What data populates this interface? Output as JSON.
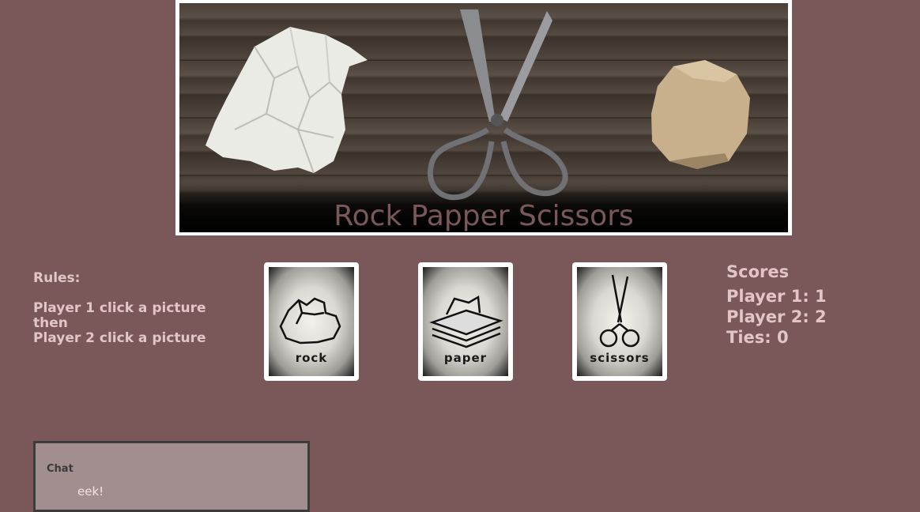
{
  "banner": {
    "title": "Rock Papper Scissors",
    "title_color": "#7a5759"
  },
  "rules": {
    "title": "Rules:",
    "lines": [
      "Player 1 click a picture",
      "then",
      "Player 2 click a picture"
    ]
  },
  "choices": [
    {
      "label": "rock",
      "icon": "rock-icon"
    },
    {
      "label": "paper",
      "icon": "paper-icon"
    },
    {
      "label": "scissors",
      "icon": "scissors-icon"
    }
  ],
  "scores": {
    "title": "Scores",
    "player1": "Player 1: 1",
    "player2": "Player 2: 2",
    "ties": "Ties: 0"
  },
  "chat": {
    "title": "Chat",
    "messages": [
      "eek!"
    ]
  },
  "colors": {
    "background": "#7a5759",
    "text": "#e1c5c7",
    "chat_bg": "#a38e8f"
  }
}
